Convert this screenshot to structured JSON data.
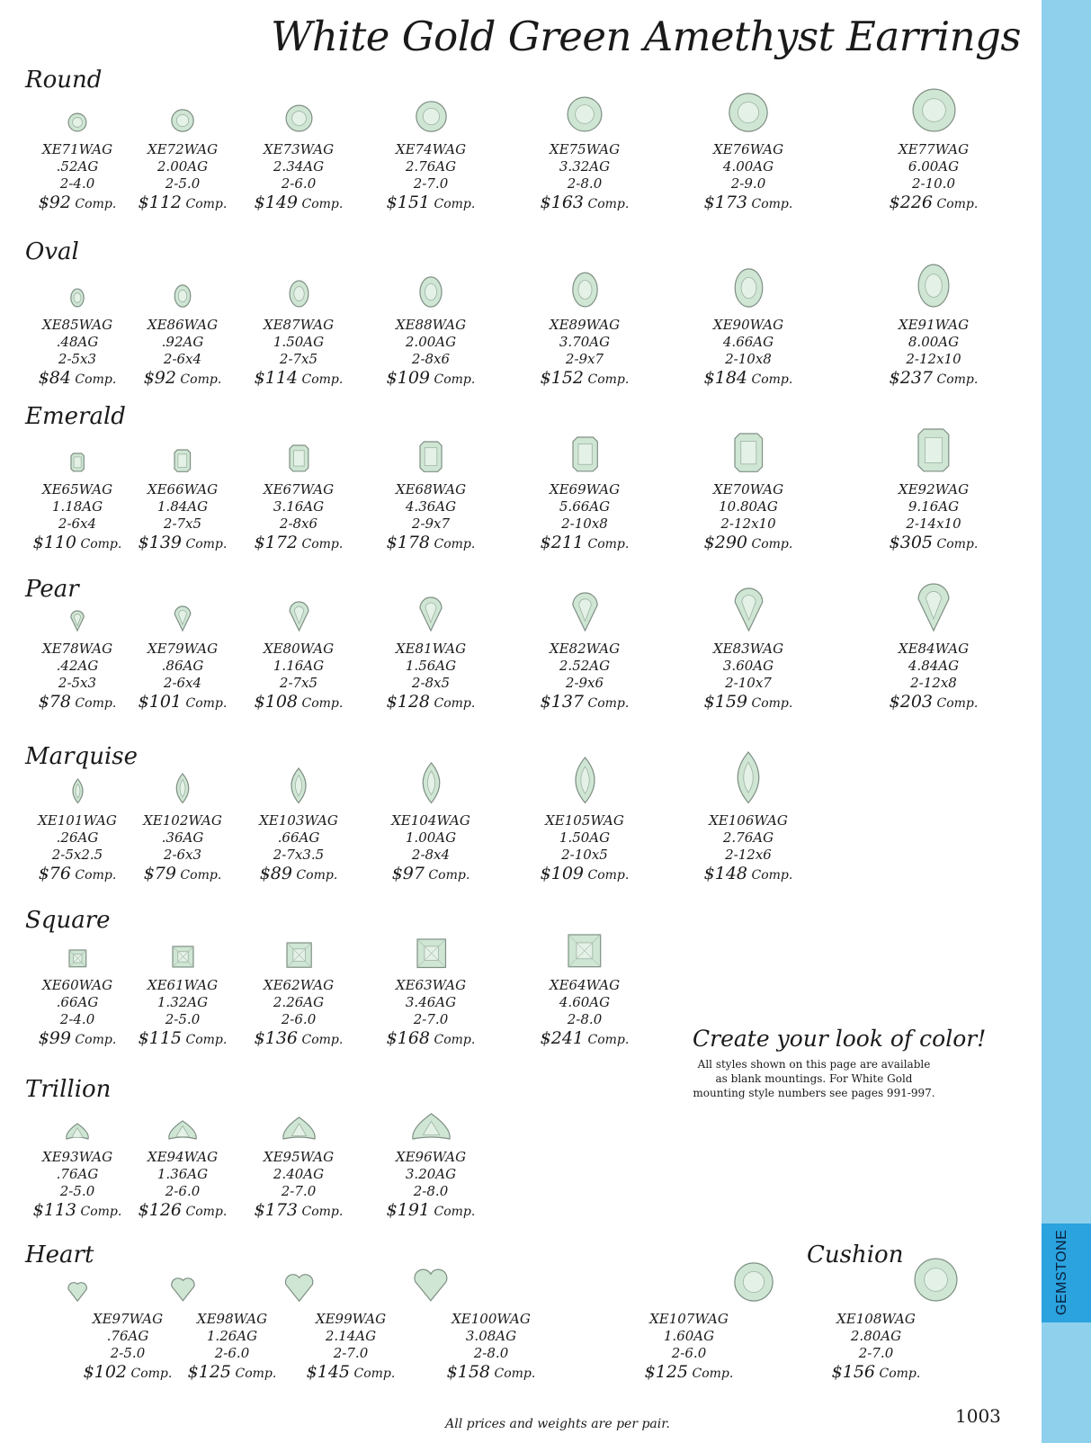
{
  "title": "White Gold Green Amethyst Earrings",
  "side_tab": "GEMSTONE",
  "page_number": "1003",
  "footer": "All prices and weights are per pair.",
  "comp_label": "Comp.",
  "promo": {
    "heading": "Create your look of color!",
    "text": "All styles shown on this page are available as blank mountings. For White Gold mounting style numbers see pages 991-997."
  },
  "cushion_label": "Cushion",
  "colors": {
    "tab_light": "#8fd0ec",
    "tab_dark": "#2aa3df",
    "stone": "#cfe6d4"
  },
  "sections": [
    {
      "label": "Round",
      "shape": "round",
      "items": [
        {
          "sku": "XE71WAG",
          "weight": ".52AG",
          "size": "2-4.0",
          "price": "$92"
        },
        {
          "sku": "XE72WAG",
          "weight": "2.00AG",
          "size": "2-5.0",
          "price": "$112"
        },
        {
          "sku": "XE73WAG",
          "weight": "2.34AG",
          "size": "2-6.0",
          "price": "$149"
        },
        {
          "sku": "XE74WAG",
          "weight": "2.76AG",
          "size": "2-7.0",
          "price": "$151"
        },
        {
          "sku": "XE75WAG",
          "weight": "3.32AG",
          "size": "2-8.0",
          "price": "$163"
        },
        {
          "sku": "XE76WAG",
          "weight": "4.00AG",
          "size": "2-9.0",
          "price": "$173"
        },
        {
          "sku": "XE77WAG",
          "weight": "6.00AG",
          "size": "2-10.0",
          "price": "$226"
        }
      ]
    },
    {
      "label": "Oval",
      "shape": "oval",
      "items": [
        {
          "sku": "XE85WAG",
          "weight": ".48AG",
          "size": "2-5x3",
          "price": "$84"
        },
        {
          "sku": "XE86WAG",
          "weight": ".92AG",
          "size": "2-6x4",
          "price": "$92"
        },
        {
          "sku": "XE87WAG",
          "weight": "1.50AG",
          "size": "2-7x5",
          "price": "$114"
        },
        {
          "sku": "XE88WAG",
          "weight": "2.00AG",
          "size": "2-8x6",
          "price": "$109"
        },
        {
          "sku": "XE89WAG",
          "weight": "3.70AG",
          "size": "2-9x7",
          "price": "$152"
        },
        {
          "sku": "XE90WAG",
          "weight": "4.66AG",
          "size": "2-10x8",
          "price": "$184"
        },
        {
          "sku": "XE91WAG",
          "weight": "8.00AG",
          "size": "2-12x10",
          "price": "$237"
        }
      ]
    },
    {
      "label": "Emerald",
      "shape": "emerald",
      "items": [
        {
          "sku": "XE65WAG",
          "weight": "1.18AG",
          "size": "2-6x4",
          "price": "$110"
        },
        {
          "sku": "XE66WAG",
          "weight": "1.84AG",
          "size": "2-7x5",
          "price": "$139"
        },
        {
          "sku": "XE67WAG",
          "weight": "3.16AG",
          "size": "2-8x6",
          "price": "$172"
        },
        {
          "sku": "XE68WAG",
          "weight": "4.36AG",
          "size": "2-9x7",
          "price": "$178"
        },
        {
          "sku": "XE69WAG",
          "weight": "5.66AG",
          "size": "2-10x8",
          "price": "$211"
        },
        {
          "sku": "XE70WAG",
          "weight": "10.80AG",
          "size": "2-12x10",
          "price": "$290"
        },
        {
          "sku": "XE92WAG",
          "weight": "9.16AG",
          "size": "2-14x10",
          "price": "$305"
        }
      ]
    },
    {
      "label": "Pear",
      "shape": "pear",
      "items": [
        {
          "sku": "XE78WAG",
          "weight": ".42AG",
          "size": "2-5x3",
          "price": "$78"
        },
        {
          "sku": "XE79WAG",
          "weight": ".86AG",
          "size": "2-6x4",
          "price": "$101"
        },
        {
          "sku": "XE80WAG",
          "weight": "1.16AG",
          "size": "2-7x5",
          "price": "$108"
        },
        {
          "sku": "XE81WAG",
          "weight": "1.56AG",
          "size": "2-8x5",
          "price": "$128"
        },
        {
          "sku": "XE82WAG",
          "weight": "2.52AG",
          "size": "2-9x6",
          "price": "$137"
        },
        {
          "sku": "XE83WAG",
          "weight": "3.60AG",
          "size": "2-10x7",
          "price": "$159"
        },
        {
          "sku": "XE84WAG",
          "weight": "4.84AG",
          "size": "2-12x8",
          "price": "$203"
        }
      ]
    },
    {
      "label": "Marquise",
      "shape": "marquise",
      "items": [
        {
          "sku": "XE101WAG",
          "weight": ".26AG",
          "size": "2-5x2.5",
          "price": "$76"
        },
        {
          "sku": "XE102WAG",
          "weight": ".36AG",
          "size": "2-6x3",
          "price": "$79"
        },
        {
          "sku": "XE103WAG",
          "weight": ".66AG",
          "size": "2-7x3.5",
          "price": "$89"
        },
        {
          "sku": "XE104WAG",
          "weight": "1.00AG",
          "size": "2-8x4",
          "price": "$97"
        },
        {
          "sku": "XE105WAG",
          "weight": "1.50AG",
          "size": "2-10x5",
          "price": "$109"
        },
        {
          "sku": "XE106WAG",
          "weight": "2.76AG",
          "size": "2-12x6",
          "price": "$148"
        }
      ]
    },
    {
      "label": "Square",
      "shape": "square",
      "items": [
        {
          "sku": "XE60WAG",
          "weight": ".66AG",
          "size": "2-4.0",
          "price": "$99"
        },
        {
          "sku": "XE61WAG",
          "weight": "1.32AG",
          "size": "2-5.0",
          "price": "$115"
        },
        {
          "sku": "XE62WAG",
          "weight": "2.26AG",
          "size": "2-6.0",
          "price": "$136"
        },
        {
          "sku": "XE63WAG",
          "weight": "3.46AG",
          "size": "2-7.0",
          "price": "$168"
        },
        {
          "sku": "XE64WAG",
          "weight": "4.60AG",
          "size": "2-8.0",
          "price": "$241"
        }
      ]
    },
    {
      "label": "Trillion",
      "shape": "trillion",
      "items": [
        {
          "sku": "XE93WAG",
          "weight": ".76AG",
          "size": "2-5.0",
          "price": "$113"
        },
        {
          "sku": "XE94WAG",
          "weight": "1.36AG",
          "size": "2-6.0",
          "price": "$126"
        },
        {
          "sku": "XE95WAG",
          "weight": "2.40AG",
          "size": "2-7.0",
          "price": "$173"
        },
        {
          "sku": "XE96WAG",
          "weight": "3.20AG",
          "size": "2-8.0",
          "price": "$191"
        }
      ]
    },
    {
      "label": "Heart",
      "shape": "heart",
      "items": [
        {
          "sku": "XE97WAG",
          "weight": ".76AG",
          "size": "2-5.0",
          "price": "$102"
        },
        {
          "sku": "XE98WAG",
          "weight": "1.26AG",
          "size": "2-6.0",
          "price": "$125"
        },
        {
          "sku": "XE99WAG",
          "weight": "2.14AG",
          "size": "2-7.0",
          "price": "$145"
        },
        {
          "sku": "XE100WAG",
          "weight": "3.08AG",
          "size": "2-8.0",
          "price": "$158"
        }
      ]
    },
    {
      "label": "",
      "shape": "cushion",
      "items": [
        {
          "sku": "XE107WAG",
          "weight": "1.60AG",
          "size": "2-6.0",
          "price": "$125"
        },
        {
          "sku": "XE108WAG",
          "weight": "2.80AG",
          "size": "2-7.0",
          "price": "$156"
        }
      ]
    }
  ]
}
